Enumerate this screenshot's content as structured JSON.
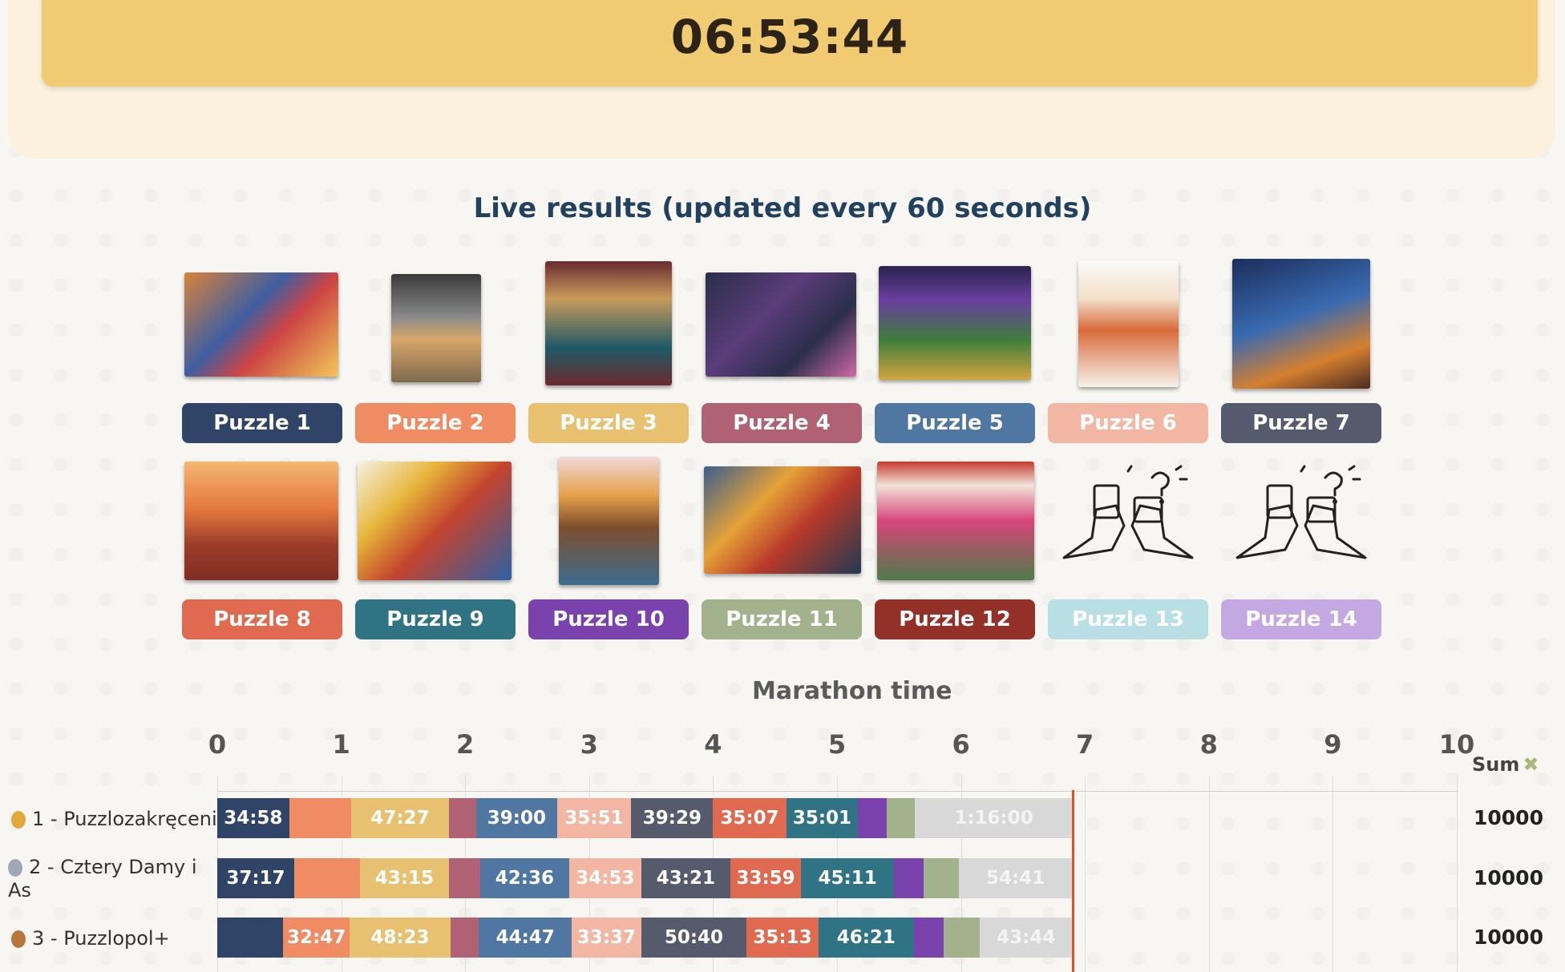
{
  "timer": "06:53:44",
  "live_title": "Live results (updated every 60 seconds)",
  "puzzles": [
    {
      "label": "Puzzle 1",
      "color": "#2f4467"
    },
    {
      "label": "Puzzle 2",
      "color": "#ef8c63"
    },
    {
      "label": "Puzzle 3",
      "color": "#e8c170"
    },
    {
      "label": "Puzzle 4",
      "color": "#b06274"
    },
    {
      "label": "Puzzle 5",
      "color": "#4f77a2"
    },
    {
      "label": "Puzzle 6",
      "color": "#f2b6a3"
    },
    {
      "label": "Puzzle 7",
      "color": "#555a6c"
    },
    {
      "label": "Puzzle 8",
      "color": "#e06a4f"
    },
    {
      "label": "Puzzle 9",
      "color": "#2f7384"
    },
    {
      "label": "Puzzle 10",
      "color": "#7a42ad"
    },
    {
      "label": "Puzzle 11",
      "color": "#a2b28c"
    },
    {
      "label": "Puzzle 12",
      "color": "#933028"
    },
    {
      "label": "Puzzle 13",
      "color": "#b8e0e4"
    },
    {
      "label": "Puzzle 14",
      "color": "#c4a8e2"
    }
  ],
  "chart_data": {
    "type": "bar",
    "title": "Marathon time",
    "x_ticks": [
      "0",
      "1",
      "2",
      "3",
      "4",
      "5",
      "6",
      "7",
      "8",
      "9",
      "10"
    ],
    "xlim": [
      0,
      10
    ],
    "sum_label": "Sum",
    "current_time_marker": 6.9,
    "rows": [
      {
        "label": "1 - Puzzlozakręceni",
        "medal": "gold",
        "sum": "10000",
        "segments": [
          {
            "puzzle": 1,
            "start": 0.0,
            "end": 0.58,
            "text": "34:58"
          },
          {
            "puzzle": 2,
            "start": 0.58,
            "end": 1.08,
            "text": ""
          },
          {
            "puzzle": 3,
            "start": 1.08,
            "end": 1.87,
            "text": "47:27"
          },
          {
            "puzzle": 4,
            "start": 1.87,
            "end": 2.09,
            "text": ""
          },
          {
            "puzzle": 5,
            "start": 2.09,
            "end": 2.74,
            "text": "39:00"
          },
          {
            "puzzle": 6,
            "start": 2.74,
            "end": 3.34,
            "text": "35:51"
          },
          {
            "puzzle": 7,
            "start": 3.34,
            "end": 4.0,
            "text": "39:29"
          },
          {
            "puzzle": 8,
            "start": 4.0,
            "end": 4.59,
            "text": "35:07"
          },
          {
            "puzzle": 9,
            "start": 4.59,
            "end": 5.17,
            "text": "35:01"
          },
          {
            "puzzle": 10,
            "start": 5.17,
            "end": 5.4,
            "text": ""
          },
          {
            "puzzle": 11,
            "start": 5.4,
            "end": 5.63,
            "text": ""
          },
          {
            "puzzle": "unfinished",
            "start": 5.63,
            "end": 6.9,
            "text": "1:16:00"
          }
        ]
      },
      {
        "label": "2 - Cztery Damy i As",
        "medal": "silver",
        "sum": "10000",
        "segments": [
          {
            "puzzle": 1,
            "start": 0.0,
            "end": 0.62,
            "text": "37:17"
          },
          {
            "puzzle": 2,
            "start": 0.62,
            "end": 1.15,
            "text": ""
          },
          {
            "puzzle": 3,
            "start": 1.15,
            "end": 1.87,
            "text": "43:15"
          },
          {
            "puzzle": 4,
            "start": 1.87,
            "end": 2.12,
            "text": ""
          },
          {
            "puzzle": 5,
            "start": 2.12,
            "end": 2.84,
            "text": "42:36"
          },
          {
            "puzzle": 6,
            "start": 2.84,
            "end": 3.42,
            "text": "34:53"
          },
          {
            "puzzle": 7,
            "start": 3.42,
            "end": 4.14,
            "text": "43:21"
          },
          {
            "puzzle": 8,
            "start": 4.14,
            "end": 4.71,
            "text": "33:59"
          },
          {
            "puzzle": 9,
            "start": 4.71,
            "end": 5.46,
            "text": "45:11"
          },
          {
            "puzzle": 10,
            "start": 5.46,
            "end": 5.7,
            "text": ""
          },
          {
            "puzzle": 11,
            "start": 5.7,
            "end": 5.98,
            "text": ""
          },
          {
            "puzzle": "unfinished",
            "start": 5.98,
            "end": 6.9,
            "text": "54:41"
          }
        ]
      },
      {
        "label": "3 - Puzzlopol+",
        "medal": "bronze",
        "sum": "10000",
        "segments": [
          {
            "puzzle": 1,
            "start": 0.0,
            "end": 0.53,
            "text": ""
          },
          {
            "puzzle": 2,
            "start": 0.53,
            "end": 1.07,
            "text": "32:47"
          },
          {
            "puzzle": 3,
            "start": 1.07,
            "end": 1.88,
            "text": "48:23"
          },
          {
            "puzzle": 4,
            "start": 1.88,
            "end": 2.11,
            "text": ""
          },
          {
            "puzzle": 5,
            "start": 2.11,
            "end": 2.86,
            "text": "44:47"
          },
          {
            "puzzle": 6,
            "start": 2.86,
            "end": 3.42,
            "text": "33:37"
          },
          {
            "puzzle": 7,
            "start": 3.42,
            "end": 4.27,
            "text": "50:40"
          },
          {
            "puzzle": 8,
            "start": 4.27,
            "end": 4.85,
            "text": "35:13"
          },
          {
            "puzzle": 9,
            "start": 4.85,
            "end": 5.62,
            "text": "46:21"
          },
          {
            "puzzle": 10,
            "start": 5.62,
            "end": 5.86,
            "text": ""
          },
          {
            "puzzle": 11,
            "start": 5.86,
            "end": 6.15,
            "text": ""
          },
          {
            "puzzle": "unfinished",
            "start": 6.15,
            "end": 6.9,
            "text": "43:44"
          }
        ]
      }
    ]
  }
}
